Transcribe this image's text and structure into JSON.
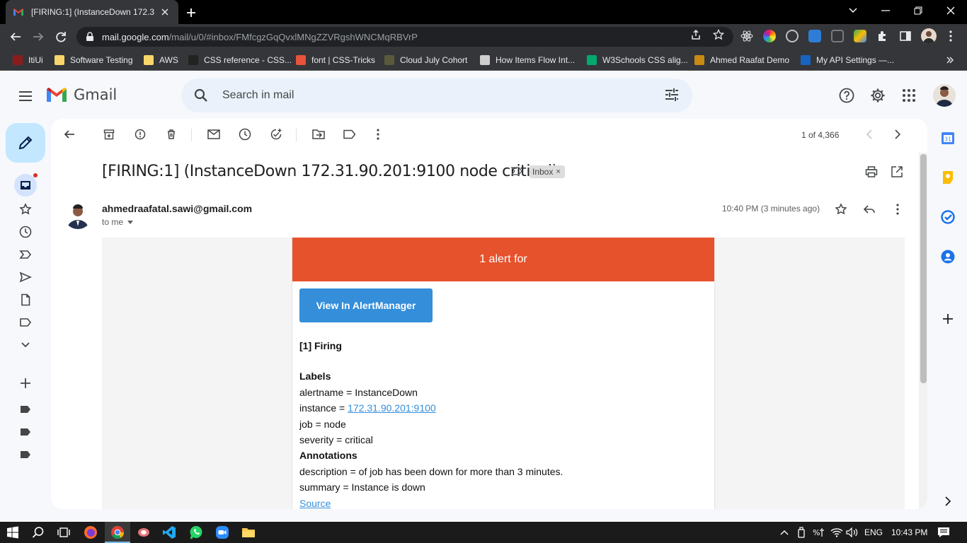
{
  "browser": {
    "tab_title": "[FIRING:1] (InstanceDown 172.31.",
    "url_host": "mail.google.com",
    "url_path": "/mail/u/0/#inbox/FMfcgzGqQvxlMNgZZVRgshWNCMqRBVrP",
    "bookmarks": [
      {
        "label": "ItiUi",
        "color": "#8b1c1c"
      },
      {
        "label": "Software Testing",
        "color": "#f9d66b"
      },
      {
        "label": "AWS",
        "color": "#f9d66b"
      },
      {
        "label": "CSS reference - CSS...",
        "color": "#222222"
      },
      {
        "label": "font | CSS-Tricks",
        "color": "#e8533b"
      },
      {
        "label": "Cloud July Cohort",
        "color": "#5a5a3a"
      },
      {
        "label": "How Items Flow Int...",
        "color": "#cfcfcf"
      },
      {
        "label": "W3Schools CSS alig...",
        "color": "#04aa6d"
      },
      {
        "label": "Ahmed Raafat Demo",
        "color": "#c98a14"
      },
      {
        "label": "My API Settings —...",
        "color": "#1565c0"
      }
    ]
  },
  "gmail": {
    "brand": "Gmail",
    "search_placeholder": "Search in mail",
    "pager": "1 of 4,366",
    "subject": "[FIRING:1] (InstanceDown 172.31.90.201:9100 node critical)",
    "label_chip": "Inbox",
    "label_chip_close": "×",
    "sender": "ahmedraafatal.sawi@gmail.com",
    "to": "to me",
    "time": "10:40 PM (3 minutes ago)"
  },
  "email": {
    "banner": "1 alert for",
    "button": "View In AlertManager",
    "firing": "[1] Firing",
    "labels_heading": "Labels",
    "alertname": "alertname = InstanceDown",
    "instance_prefix": "instance = ",
    "instance_link": "172.31.90.201:9100",
    "job": "job = node",
    "severity": "severity = critical",
    "annotations_heading": "Annotations",
    "description": "description = of job has been down for more than 3 minutes.",
    "summary": "summary = Instance is down",
    "source_link": "Source",
    "colors": {
      "banner": "#e6522c",
      "button": "#348eda"
    }
  },
  "taskbar": {
    "lang": "ENG",
    "clock": "10:43 PM"
  }
}
